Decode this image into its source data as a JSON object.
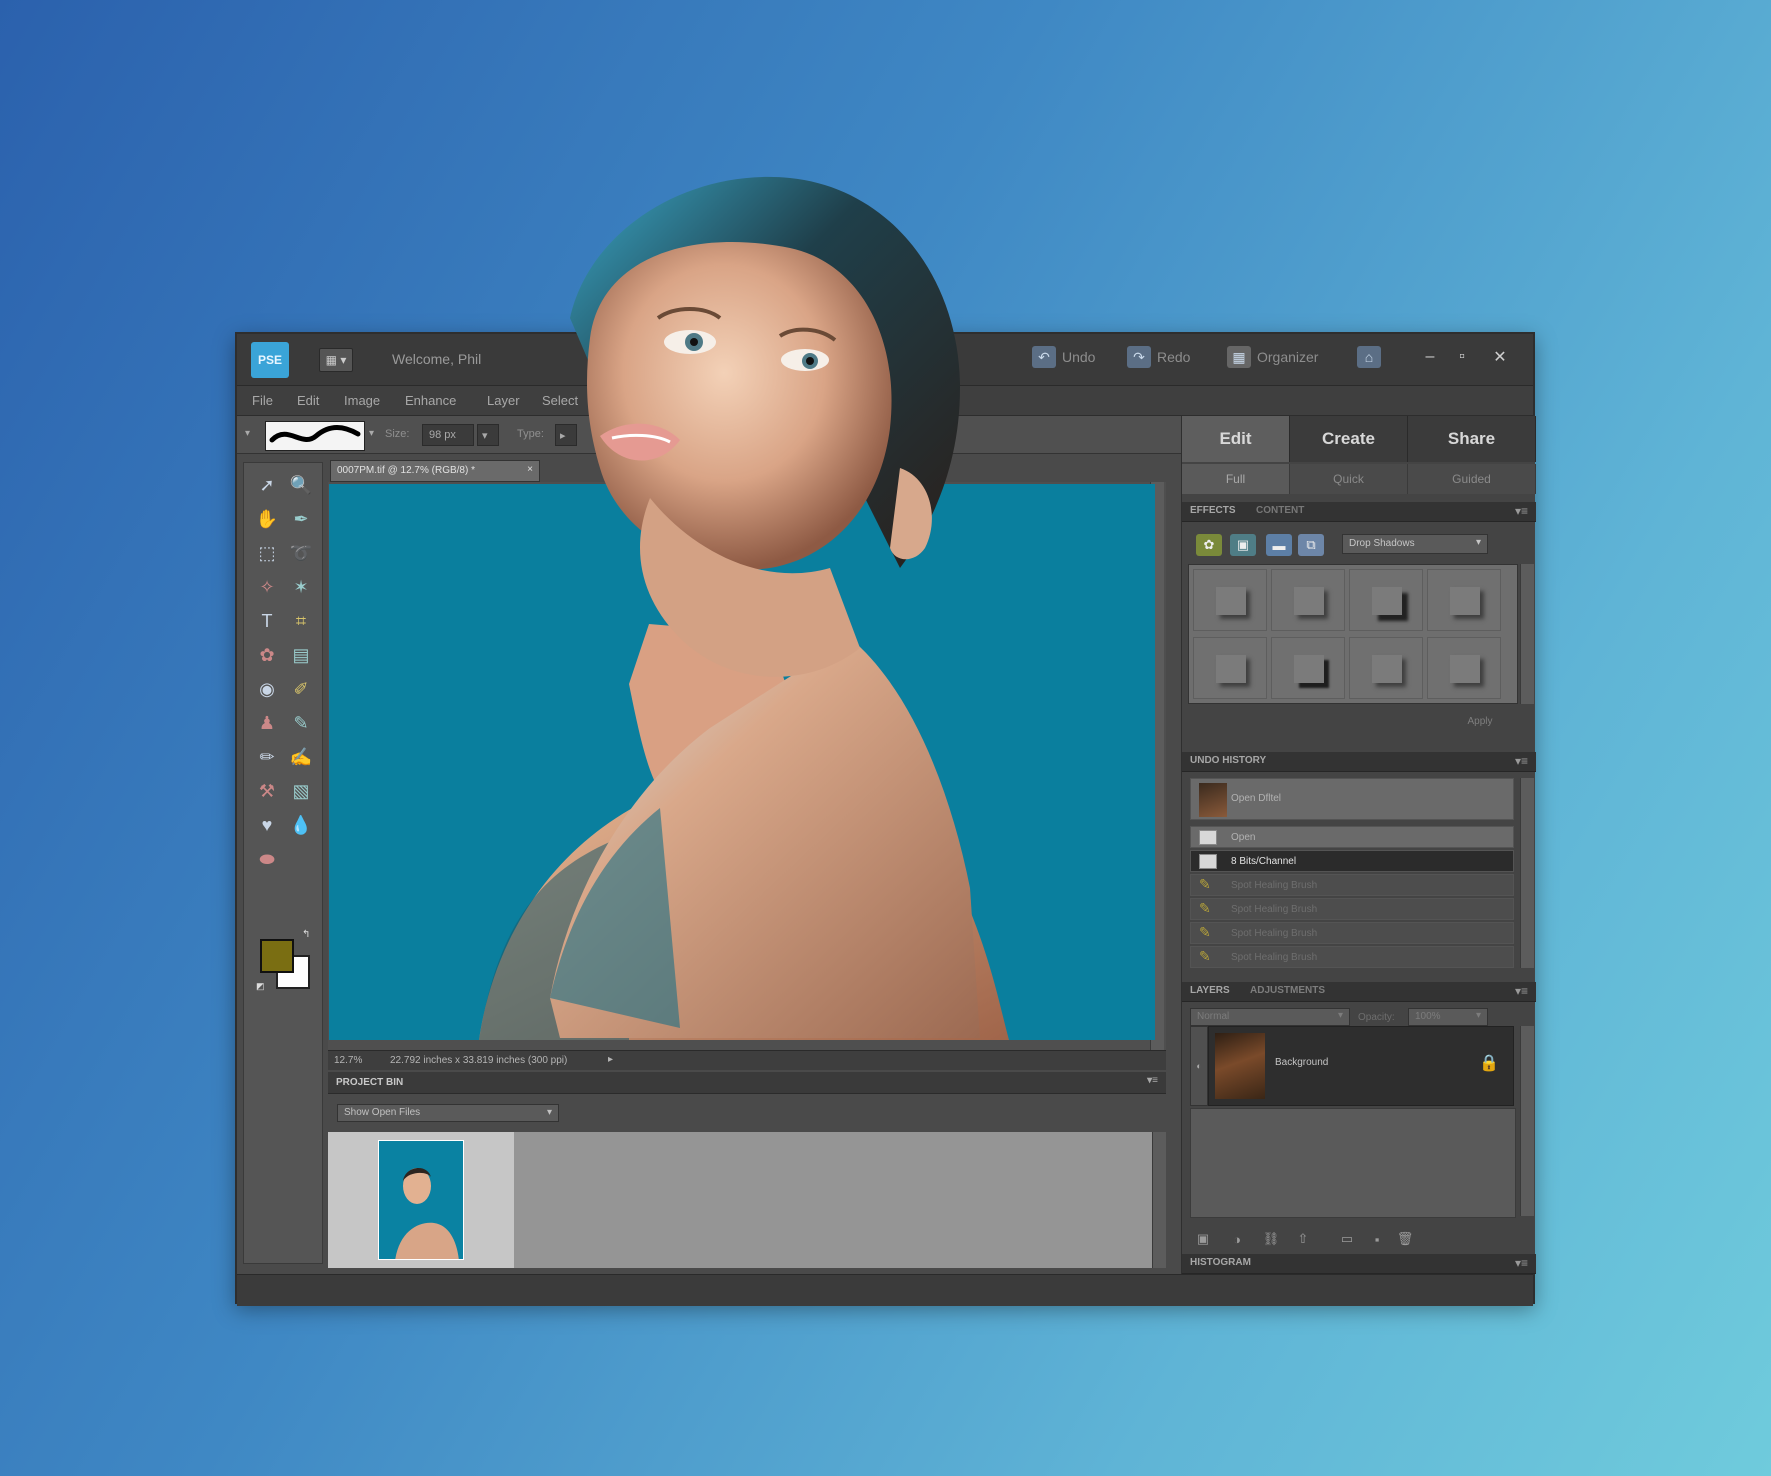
{
  "app": {
    "logo": "PSE",
    "title": "Welcome, Phil",
    "actions": [
      {
        "label": "Undo",
        "icon": "undo-icon",
        "glyph": "↶"
      },
      {
        "label": "Redo",
        "icon": "redo-icon",
        "glyph": "↷"
      },
      {
        "label": "Organizer",
        "icon": "organizer-icon",
        "glyph": "▦"
      }
    ],
    "home_glyph": "⌂",
    "window_controls": {
      "minimize": "–",
      "maximize": "▫",
      "close": "✕"
    }
  },
  "menu": [
    "File",
    "Edit",
    "Image",
    "Enhance",
    "Layer",
    "Select"
  ],
  "options_bar": {
    "size_label": "Size:",
    "size_value": "98 px",
    "type_label": "Type:"
  },
  "tools": [
    {
      "name": "move-tool",
      "glyph": "➚"
    },
    {
      "name": "zoom-tool",
      "glyph": "🔍"
    },
    {
      "name": "hand-tool",
      "glyph": "✋"
    },
    {
      "name": "eyedropper-tool",
      "glyph": "✒"
    },
    {
      "name": "marquee-tool",
      "glyph": "⬚"
    },
    {
      "name": "lasso-tool",
      "glyph": "➰"
    },
    {
      "name": "quick-selection-tool",
      "glyph": "✧"
    },
    {
      "name": "magic-wand-tool",
      "glyph": "✶"
    },
    {
      "name": "type-tool",
      "glyph": "T"
    },
    {
      "name": "crop-tool",
      "glyph": "⌗"
    },
    {
      "name": "cookie-cutter-tool",
      "glyph": "✿"
    },
    {
      "name": "straighten-tool",
      "glyph": "▤"
    },
    {
      "name": "red-eye-tool",
      "glyph": "◉"
    },
    {
      "name": "healing-brush-tool",
      "glyph": "✐"
    },
    {
      "name": "clone-stamp-tool",
      "glyph": "♟"
    },
    {
      "name": "eraser-tool",
      "glyph": "✎"
    },
    {
      "name": "pencil-tool",
      "glyph": "✏"
    },
    {
      "name": "brush-tool",
      "glyph": "✍"
    },
    {
      "name": "smart-brush-tool",
      "glyph": "⚒"
    },
    {
      "name": "gradient-tool",
      "glyph": "▧"
    },
    {
      "name": "custom-shape-tool",
      "glyph": "♥"
    },
    {
      "name": "blur-tool",
      "glyph": "💧"
    },
    {
      "name": "sponge-tool",
      "glyph": "⬬"
    }
  ],
  "colors": {
    "foreground": "#7a6e12",
    "background": "#ffffff"
  },
  "document": {
    "tab_label": "0007PM.tif @ 12.7% (RGB/8) *",
    "zoom": "12.7%",
    "doc_info": "22.792 inches x 33.819 inches (300 ppi)"
  },
  "project_bin": {
    "title": "PROJECT BIN",
    "select_value": "Show Open Files"
  },
  "right_panel": {
    "tabs": [
      "Edit",
      "Create",
      "Share"
    ],
    "subtabs": [
      "Full",
      "Quick",
      "Guided"
    ],
    "effects": {
      "tabs": [
        "EFFECTS",
        "CONTENT"
      ],
      "select_value": "Drop Shadows",
      "apply_label": "Apply"
    },
    "history": {
      "title": "UNDO HISTORY",
      "items": [
        {
          "label": "Open Dfltel",
          "type": "open"
        },
        {
          "label": "Open",
          "type": "doc"
        },
        {
          "label": "8 Bits/Channel",
          "type": "doc",
          "selected": true
        },
        {
          "label": "Spot Healing Brush",
          "type": "brush"
        },
        {
          "label": "Spot Healing Brush",
          "type": "brush"
        },
        {
          "label": "Spot Healing Brush",
          "type": "brush"
        },
        {
          "label": "Spot Healing Brush",
          "type": "brush"
        }
      ]
    },
    "layers": {
      "tabs": [
        "LAYERS",
        "ADJUSTMENTS"
      ],
      "blend_mode": "Normal",
      "opacity_label": "Opacity:",
      "opacity_value": "100%",
      "layer_name": "Background"
    },
    "histogram_title": "HISTOGRAM"
  }
}
